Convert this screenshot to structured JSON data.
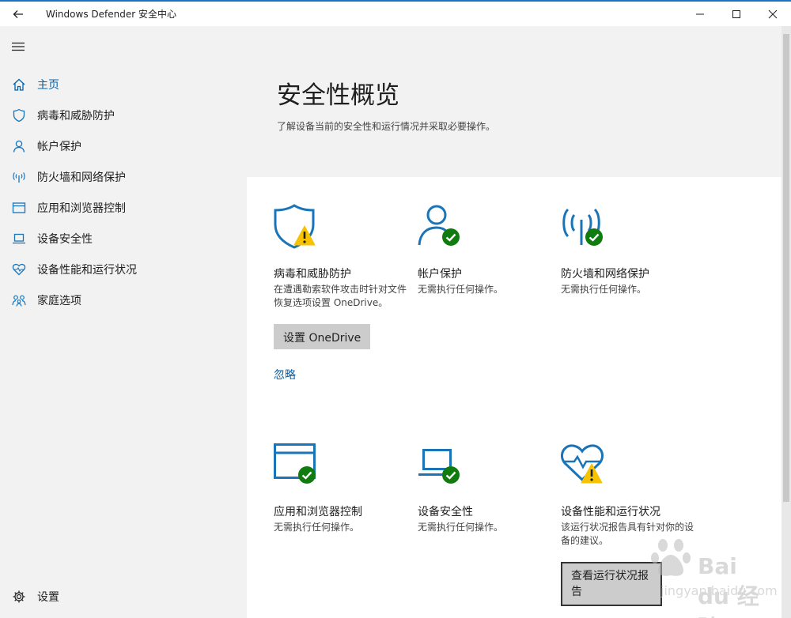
{
  "window": {
    "title": "Windows Defender 安全中心"
  },
  "sidebar": {
    "items": [
      {
        "label": "主页",
        "icon": "home-icon"
      },
      {
        "label": "病毒和威胁防护",
        "icon": "shield-icon"
      },
      {
        "label": "帐户保护",
        "icon": "person-icon"
      },
      {
        "label": "防火墙和网络保护",
        "icon": "wifi-antenna-icon"
      },
      {
        "label": "应用和浏览器控制",
        "icon": "browser-window-icon"
      },
      {
        "label": "设备安全性",
        "icon": "laptop-icon"
      },
      {
        "label": "设备性能和运行状况",
        "icon": "heart-icon"
      },
      {
        "label": "家庭选项",
        "icon": "family-icon"
      }
    ],
    "settings_label": "设置"
  },
  "main": {
    "title": "安全性概览",
    "subtitle": "了解设备当前的安全性和运行情况并采取必要操作。",
    "tiles": [
      {
        "title": "病毒和威胁防护",
        "desc": "在遭遇勒索软件攻击时针对文件恢复选项设置 OneDrive。",
        "status": "warning",
        "button": "设置 OneDrive",
        "link": "忽略"
      },
      {
        "title": "帐户保护",
        "desc": "无需执行任何操作。",
        "status": "ok"
      },
      {
        "title": "防火墙和网络保护",
        "desc": "无需执行任何操作。",
        "status": "ok"
      },
      {
        "title": "应用和浏览器控制",
        "desc": "无需执行任何操作。",
        "status": "ok"
      },
      {
        "title": "设备安全性",
        "desc": "无需执行任何操作。",
        "status": "ok"
      },
      {
        "title": "设备性能和运行状况",
        "desc": "该运行状况报告具有针对你的设备的建议。",
        "status": "warning",
        "button": "查看运行状况报告"
      }
    ]
  },
  "watermark": {
    "brand": "Bai du 经验",
    "url": "jingyan.baidu.com"
  },
  "colors": {
    "accent": "#0063b1",
    "icon_blue": "#1a74b8",
    "ok_green": "#107c10",
    "warning_yellow": "#f7c300"
  }
}
